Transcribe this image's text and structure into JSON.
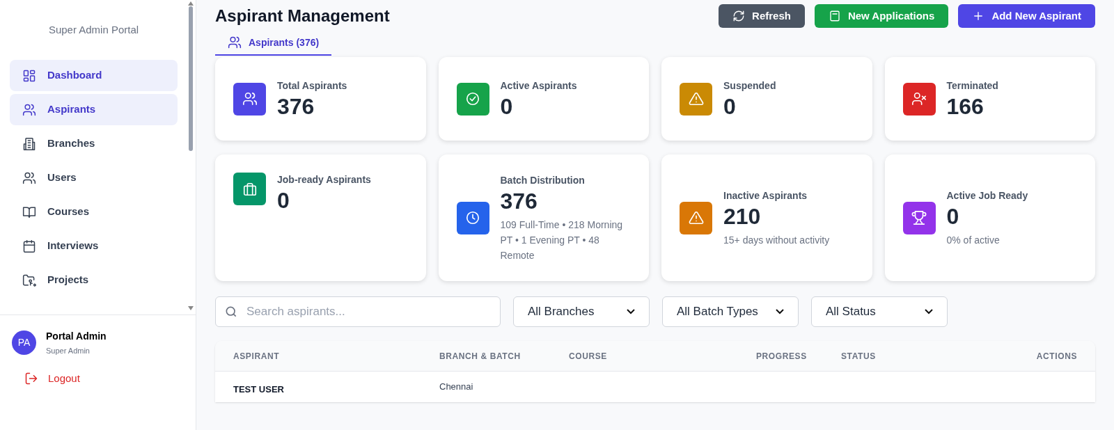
{
  "sidebar": {
    "portal_title": "Super Admin Portal",
    "items": [
      {
        "label": "Dashboard",
        "selected": true
      },
      {
        "label": "Aspirants",
        "selected": true
      },
      {
        "label": "Branches",
        "selected": false
      },
      {
        "label": "Users",
        "selected": false
      },
      {
        "label": "Courses",
        "selected": false
      },
      {
        "label": "Interviews",
        "selected": false
      },
      {
        "label": "Projects",
        "selected": false
      }
    ],
    "user": {
      "initials": "PA",
      "name": "Portal Admin",
      "role": "Super Admin"
    },
    "logout": "Logout"
  },
  "header": {
    "title": "Aspirant Management",
    "buttons": [
      {
        "label": "Refresh",
        "kind": "refresh"
      },
      {
        "label": "New Applications",
        "kind": "applications"
      },
      {
        "label": "Add New Aspirant",
        "kind": "add"
      }
    ]
  },
  "tabs": [
    {
      "label": "Aspirants (376)",
      "selected": true
    }
  ],
  "stats": [
    {
      "title": "Total Aspirants",
      "value": "376",
      "color": "#4f46e5"
    },
    {
      "title": "Active Aspirants",
      "value": "0",
      "color": "#16a34a"
    },
    {
      "title": "Suspended",
      "value": "0",
      "color": "#ca8a04"
    },
    {
      "title": "Terminated",
      "value": "166",
      "color": "#dc2626"
    },
    {
      "title": "Job-ready Aspirants",
      "value": "0",
      "color": "#059669"
    },
    {
      "title": "Batch Distribution",
      "value": "376",
      "subtitle": "109 Full-Time • 218 Morning PT • 1 Evening PT • 48 Remote",
      "color": "#2563eb"
    },
    {
      "title": "Inactive Aspirants",
      "value": "210",
      "subtitle": "15+ days without activity",
      "color": "#d97706"
    },
    {
      "title": "Active Job Ready",
      "value": "0",
      "subtitle": "0% of active",
      "color": "#9333ea"
    }
  ],
  "filters": {
    "search_placeholder": "Search aspirants...",
    "selects": [
      "All Branches",
      "All Batch Types",
      "All Status"
    ]
  },
  "table": {
    "columns": [
      "ASPIRANT",
      "BRANCH & BATCH",
      "COURSE",
      "PROGRESS",
      "STATUS",
      "ACTIONS"
    ],
    "rows": [
      [
        "TEST USER",
        "Chennai"
      ]
    ]
  }
}
